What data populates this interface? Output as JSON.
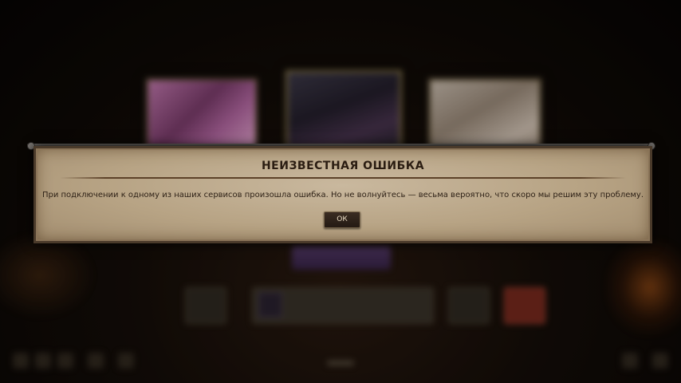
{
  "dialog": {
    "title": "НЕИЗВЕСТНАЯ ОШИБКА",
    "message": "При подключении к одному из наших сервисов произошла ошибка. Но не волнуйтесь — весьма вероятно, что скоро мы решим эту проблему.",
    "ok_label": "ОК"
  },
  "colors": {
    "dialog_parchment": "#b7a384",
    "dialog_border": "#4a3a2a",
    "title_text": "#2b1d12",
    "button_bg": "#2e2219",
    "button_text": "#e6d8c0"
  }
}
